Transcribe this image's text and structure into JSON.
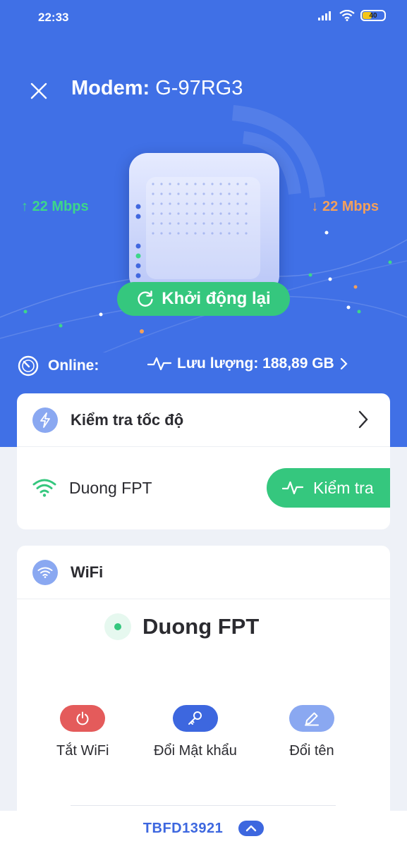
{
  "status_bar": {
    "time": "22:33",
    "battery": "40"
  },
  "header": {
    "title_prefix": "Modem:",
    "model": "G-97RG3"
  },
  "speeds": {
    "upload": "22 Mbps",
    "download": "22 Mbps",
    "upload_arrow": "↑",
    "download_arrow": "↓"
  },
  "restart_label": "Khởi động lại",
  "status": {
    "online_label": "Online:",
    "traffic_label": "Lưu lượng: 188,89 GB"
  },
  "speed_test": {
    "title": "Kiểm tra tốc độ",
    "network": "Duong FPT",
    "button": "Kiểm tra"
  },
  "wifi": {
    "title": "WiFi",
    "network": "Duong FPT",
    "actions": [
      {
        "label": "Tắt WiFi",
        "color": "#e45b5b",
        "icon": "power-icon"
      },
      {
        "label": "Đổi Mật khẩu",
        "color": "#3d67df",
        "icon": "key-icon"
      },
      {
        "label": "Đổi tên",
        "color": "#8aa8f1",
        "icon": "pencil-icon"
      }
    ]
  },
  "footer": {
    "code": "TBFD13921"
  },
  "colors": {
    "hero": "#4070e6",
    "green": "#35c77e",
    "orange": "#f3a05b",
    "accent": "#3d67df"
  }
}
